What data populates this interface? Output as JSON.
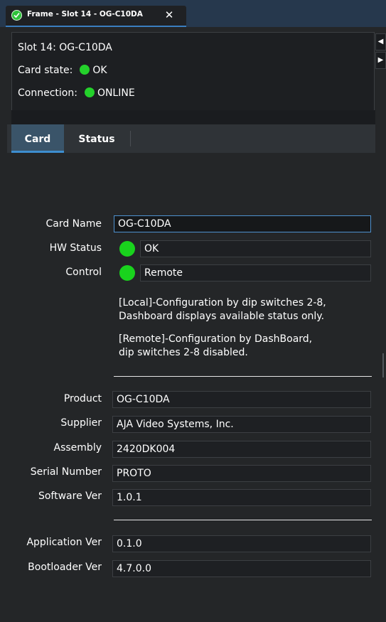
{
  "window": {
    "tab_title": "Frame - Slot 14 - OG-C10DA",
    "close_glyph": "✕"
  },
  "info": {
    "slot": "Slot 14: OG-C10DA",
    "card_state_label": "Card state:",
    "card_state_value": "OK",
    "connection_label": "Connection:",
    "connection_value": "ONLINE",
    "status_color": "#24d12b"
  },
  "tabs": [
    {
      "label": "Card",
      "active": true
    },
    {
      "label": "Status",
      "active": false
    }
  ],
  "card": {
    "card_name_label": "Card Name",
    "card_name_value": "OG-C10DA",
    "hw_status_label": "HW Status",
    "hw_status_value": "OK",
    "control_label": "Control",
    "control_value": "Remote",
    "note_local_1": "[Local]-Configuration by dip switches 2-8,",
    "note_local_2": "Dashboard displays available status only.",
    "note_remote_1": "[Remote]-Configuration by DashBoard,",
    "note_remote_2": "dip switches 2-8 disabled.",
    "product_label": "Product",
    "product_value": "OG-C10DA",
    "supplier_label": "Supplier",
    "supplier_value": "AJA Video Systems, Inc.",
    "assembly_label": "Assembly",
    "assembly_value": "2420DK004",
    "serial_label": "Serial Number",
    "serial_value": "PROTO",
    "software_label": "Software Ver",
    "software_value": "1.0.1",
    "application_label": "Application Ver",
    "application_value": "0.1.0",
    "bootloader_label": "Bootloader Ver",
    "bootloader_value": "4.7.0.0"
  },
  "colors": {
    "accent": "#3d8ed0",
    "ok_green": "#19d31d"
  }
}
